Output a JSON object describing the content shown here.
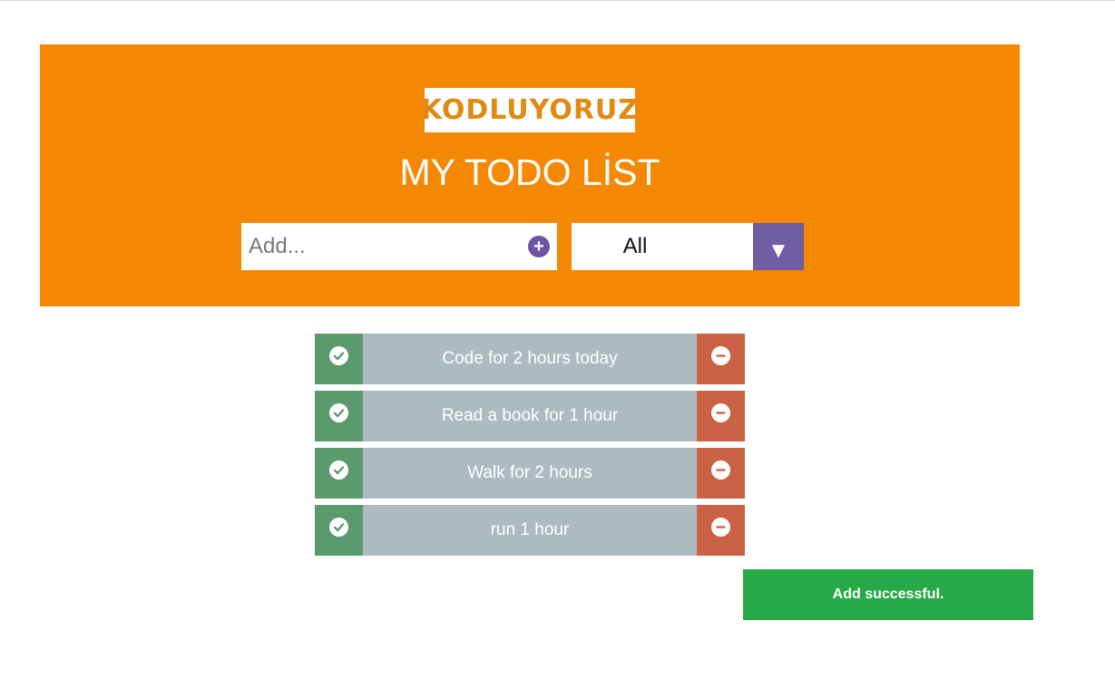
{
  "header": {
    "logo_text": "KODLUYORUZ",
    "title": "MY TODO LİST",
    "background_color": "#f58803"
  },
  "add_form": {
    "placeholder": "Add...",
    "value": "",
    "add_icon": "plus-circle-icon"
  },
  "filter": {
    "selected": "All",
    "arrow_icon": "triangle-down-icon"
  },
  "todos": [
    {
      "text": "Code for 2 hours today"
    },
    {
      "text": "Read a book for 1 hour"
    },
    {
      "text": "Walk for 2 hours"
    },
    {
      "text": "run 1 hour"
    }
  ],
  "icons": {
    "complete": "check-circle-icon",
    "remove": "minus-circle-icon"
  },
  "colors": {
    "accent_purple": "#6f52a3",
    "complete_green": "#5a9a6c",
    "remove_red": "#c96244",
    "item_gray": "#adbbc1",
    "toast_green": "#28a947"
  },
  "toast": {
    "message": "Add successful."
  }
}
